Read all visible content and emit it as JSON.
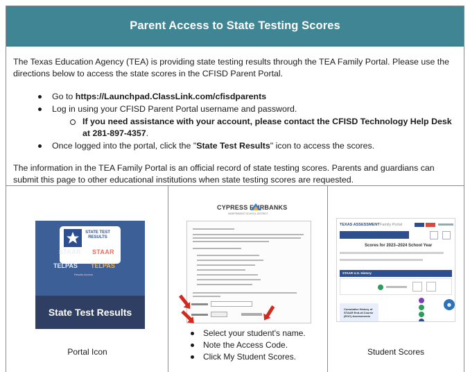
{
  "header": {
    "title": "Parent Access to State Testing Scores"
  },
  "intro": "The Texas Education Agency (TEA) is providing state testing results through the TEA Family Portal. Please use the directions below to access the state scores in the CFISD Parent Portal.",
  "steps": {
    "go_prefix": "Go to ",
    "go_url": "https://Launchpad.ClassLink.com/cfisdparents",
    "login": "Log in using your CFISD Parent Portal username and password.",
    "help": "If you need assistance with your account, please contact the CFISD Technology Help Desk at 281-897-4357",
    "help_end": ".",
    "logged_prefix": "Once logged into the portal, click the \"",
    "logged_button": "State Test Results",
    "logged_suffix": "\" icon to access the scores."
  },
  "official_note": "The information in the TEA Family Portal is an official record of state testing scores. Parents and guardians can submit this page to other educational institutions when state testing scores are requested.",
  "panels": {
    "portal_icon": {
      "tile_label": "STATE TEST RESULTS",
      "staar_1": "STAAR",
      "staar_2": "STAAR",
      "telpas_1": "TELPAS",
      "telpas_2": "TELPAS",
      "tiny": "Results Access",
      "title": "State Test Results",
      "caption": "Portal Icon"
    },
    "letter": {
      "brand": "CYPRESS FAIRBANKS",
      "brand_sub": "INDEPENDENT SCHOOL DISTRICT",
      "steps": [
        "Select your student's name.",
        "Note the Access Code.",
        "Click My Student Scores."
      ]
    },
    "scores": {
      "brand": "TEXAS ASSESSMENT",
      "family": "Family Portal",
      "headline": "Scores for 2023–2024 School Year",
      "band": "STAAR U.S. History",
      "panel_text": "Cumulative History of STAAR End-of-Course (EOC) Assessments",
      "caption": "Student Scores"
    }
  },
  "colors": {
    "banner": "#3f8594",
    "icon_blue": "#2f3f63",
    "arrow_red": "#d32a1e"
  }
}
